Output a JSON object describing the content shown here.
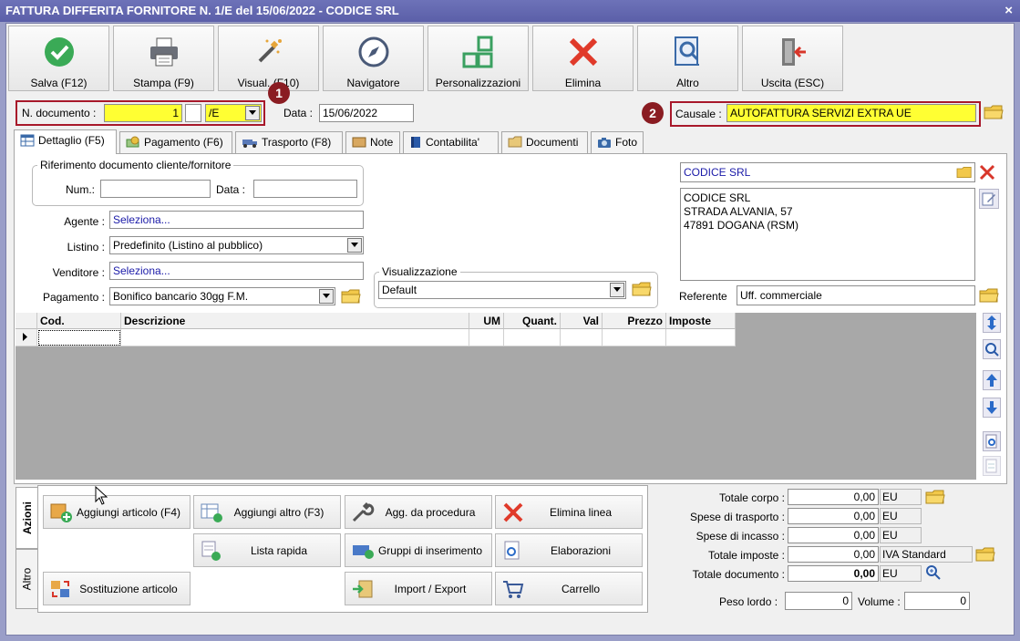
{
  "window": {
    "title": "FATTURA DIFFERITA FORNITORE N. 1/E del 15/06/2022 - CODICE SRL",
    "close_glyph": "×"
  },
  "toolbar": [
    {
      "label": "Salva (F12)",
      "icon": "check-circle-icon"
    },
    {
      "label": "Stampa (F9)",
      "icon": "printer-icon"
    },
    {
      "label": "Visual. (F10)",
      "icon": "magic-wand-icon"
    },
    {
      "label": "Navigatore",
      "icon": "compass-icon"
    },
    {
      "label": "Personalizzazioni",
      "icon": "grid-squares-icon"
    },
    {
      "label": "Elimina",
      "icon": "red-x-icon"
    },
    {
      "label": "Altro",
      "icon": "magnifier-doc-icon"
    },
    {
      "label": "Uscita (ESC)",
      "icon": "exit-door-icon"
    }
  ],
  "header": {
    "doc_label": "N. documento :",
    "doc_number": "1",
    "doc_suffix": "/E",
    "date_label": "Data :",
    "date_value": "15/06/2022",
    "causale_label": "Causale :",
    "causale_value": "AUTOFATTURA SERVIZI EXTRA UE",
    "badge1": "1",
    "badge2": "2"
  },
  "tabs": [
    {
      "label": "Dettaglio (F5)",
      "icon": "table-icon"
    },
    {
      "label": "Pagamento (F6)",
      "icon": "money-icon"
    },
    {
      "label": "Trasporto (F8)",
      "icon": "truck-icon"
    },
    {
      "label": "Note",
      "icon": "note-icon"
    },
    {
      "label": "Contabilita'",
      "icon": "book-icon"
    },
    {
      "label": "Documenti",
      "icon": "folder-icon"
    },
    {
      "label": "Foto",
      "icon": "camera-icon"
    }
  ],
  "riferimento": {
    "legend": "Riferimento documento cliente/fornitore",
    "num_label": "Num.:",
    "num_value": "",
    "data_label": "Data :",
    "data_value": ""
  },
  "form": {
    "agente_label": "Agente :",
    "agente_value": "Seleziona...",
    "listino_label": "Listino :",
    "listino_value": "Predefinito (Listino al pubblico)",
    "venditore_label": "Venditore :",
    "venditore_value": "Seleziona...",
    "pagamento_label": "Pagamento :",
    "pagamento_value": "Bonifico bancario 30gg F.M.",
    "visual_legend": "Visualizzazione",
    "visual_value": "Default"
  },
  "supplier": {
    "name": "CODICE SRL",
    "address_line1": "CODICE SRL",
    "address_line2": "STRADA ALVANIA, 57",
    "address_line3": "47891 DOGANA (RSM)",
    "referente_label": "Referente",
    "referente_value": "Uff. commerciale"
  },
  "grid": {
    "columns": [
      "Cod.",
      "Descrizione",
      "UM",
      "Quant.",
      "Val",
      "Prezzo",
      "Imposte"
    ]
  },
  "actions": {
    "tab_azioni": "Azioni",
    "tab_altro": "Altro",
    "buttons": [
      {
        "label": "Aggiungi articolo (F4)",
        "icon": "add-box-icon"
      },
      {
        "label": "Aggiungi altro (F3)",
        "icon": "add-table-icon"
      },
      {
        "label": "Agg. da procedura",
        "icon": "wrench-icon"
      },
      {
        "label": "Elimina linea",
        "icon": "red-x-icon"
      },
      {
        "label": "Lista rapida",
        "icon": "quick-list-icon"
      },
      {
        "label": "Gruppi di inserimento",
        "icon": "group-insert-icon"
      },
      {
        "label": "Elaborazioni",
        "icon": "gear-doc-icon"
      },
      {
        "label": "Sostituzione articolo",
        "icon": "swap-icon"
      },
      {
        "label": "Import / Export",
        "icon": "import-export-icon"
      },
      {
        "label": "Carrello",
        "icon": "cart-icon"
      }
    ]
  },
  "totals": {
    "corpo_label": "Totale corpo :",
    "corpo_value": "0,00",
    "corpo_unit": "EU",
    "trasporto_label": "Spese di trasporto :",
    "trasporto_value": "0,00",
    "trasporto_unit": "EU",
    "incasso_label": "Spese di incasso :",
    "incasso_value": "0,00",
    "incasso_unit": "EU",
    "imposte_label": "Totale imposte :",
    "imposte_value": "0,00",
    "imposte_unit": "IVA Standard",
    "documento_label": "Totale documento :",
    "documento_value": "0,00",
    "documento_unit": "EU",
    "peso_label": "Peso lordo :",
    "peso_value": "0",
    "volume_label": "Volume :",
    "volume_value": "0"
  },
  "colors": {
    "highlight_yellow": "#ffff33",
    "badge_red": "#8a1c22",
    "frame_blue": "#9a9ec8"
  }
}
